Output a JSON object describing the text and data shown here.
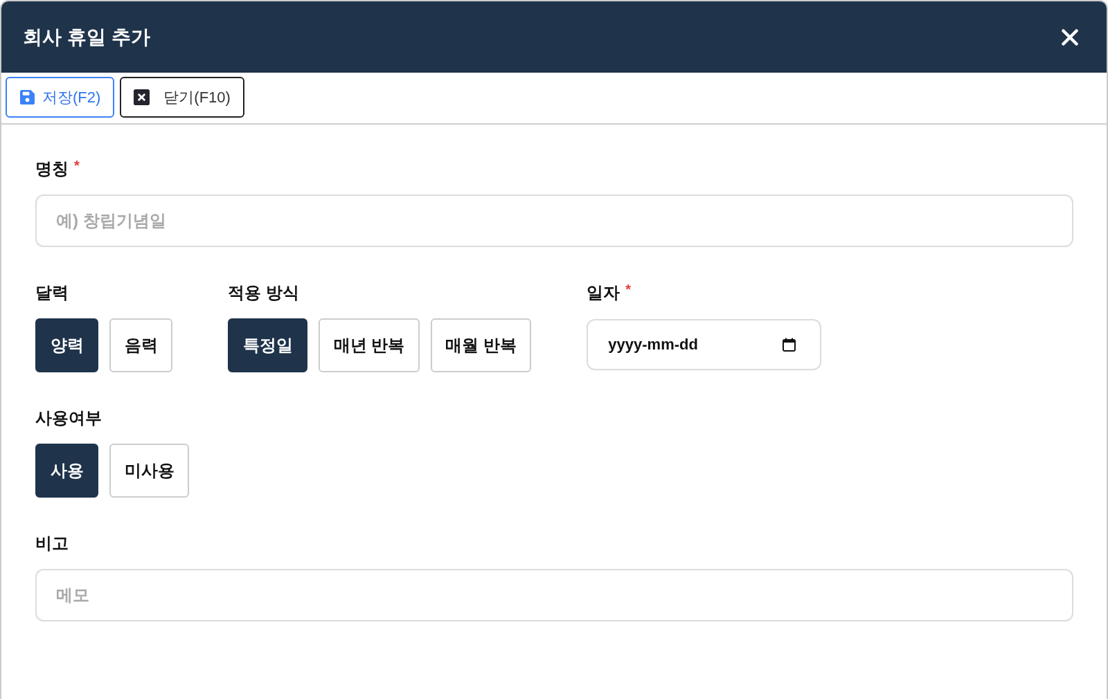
{
  "dialog": {
    "title": "회사 휴일 추가"
  },
  "toolbar": [
    {
      "kind": "save",
      "label": "저장(F2)"
    },
    {
      "kind": "close",
      "label": "닫기(F10)"
    }
  ],
  "name_field": {
    "label": "명칭",
    "required_mark": "*",
    "placeholder": "예) 창립기념일"
  },
  "calendar": {
    "label": "달력",
    "options": [
      {
        "label": "양력",
        "selected": true
      },
      {
        "label": "음력",
        "selected": false
      }
    ]
  },
  "apply_mode": {
    "label": "적용 방식",
    "options": [
      {
        "label": "특정일",
        "selected": true
      },
      {
        "label": "매년 반복",
        "selected": false
      },
      {
        "label": "매월 반복",
        "selected": false
      }
    ]
  },
  "date_field": {
    "label": "일자",
    "required_mark": "*",
    "placeholder": "yyyy-mm-dd"
  },
  "usage": {
    "label": "사용여부",
    "options": [
      {
        "label": "사용",
        "selected": true
      },
      {
        "label": "미사용",
        "selected": false
      }
    ]
  },
  "note_field": {
    "label": "비고",
    "placeholder": "메모"
  }
}
